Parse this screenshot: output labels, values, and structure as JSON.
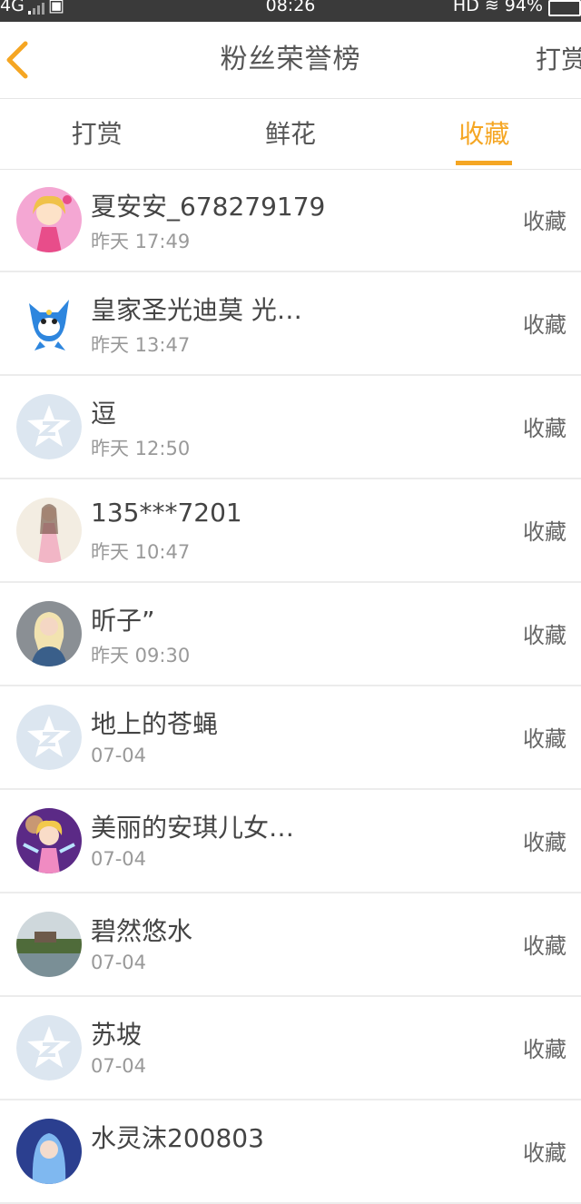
{
  "status": {
    "network": "4G",
    "time": "08:26",
    "hd": "HD",
    "battery": "94%"
  },
  "nav": {
    "title": "粉丝荣誉榜",
    "action": "打赏"
  },
  "tabs": [
    {
      "label": "打赏"
    },
    {
      "label": "鲜花"
    },
    {
      "label": "收藏"
    }
  ],
  "colors": {
    "accent": "#f5a623",
    "placeholder": "#dce6f0"
  },
  "rows": [
    {
      "name": "夏安安_678279179",
      "time": "昨天 17:49",
      "badge": "收藏",
      "avatar": "pink-cartoon-girl"
    },
    {
      "name": "皇家圣光迪莫 光…",
      "time": "昨天 13:47",
      "badge": "收藏",
      "avatar": "blue-cartoon-creature"
    },
    {
      "name": "逗",
      "time": "昨天 12:50",
      "badge": "收藏",
      "avatar": "default-qzone-star"
    },
    {
      "name": "135***7201",
      "time": "昨天 10:47",
      "badge": "收藏",
      "avatar": "costume-illustration"
    },
    {
      "name": "昕子”",
      "time": "昨天 09:30",
      "badge": "收藏",
      "avatar": "blonde-girl-photo"
    },
    {
      "name": "地上的苍蝇",
      "time": "07-04",
      "badge": "收藏",
      "avatar": "default-qzone-star"
    },
    {
      "name": "美丽的安琪儿女…",
      "time": "07-04",
      "badge": "收藏",
      "avatar": "anime-fairy"
    },
    {
      "name": "碧然悠水",
      "time": "07-04",
      "badge": "收藏",
      "avatar": "landscape-photo"
    },
    {
      "name": "苏坡",
      "time": "07-04",
      "badge": "收藏",
      "avatar": "default-qzone-star"
    },
    {
      "name": "水灵沫200803",
      "time": "",
      "badge": "收藏",
      "avatar": "anime-blue-hair"
    }
  ]
}
